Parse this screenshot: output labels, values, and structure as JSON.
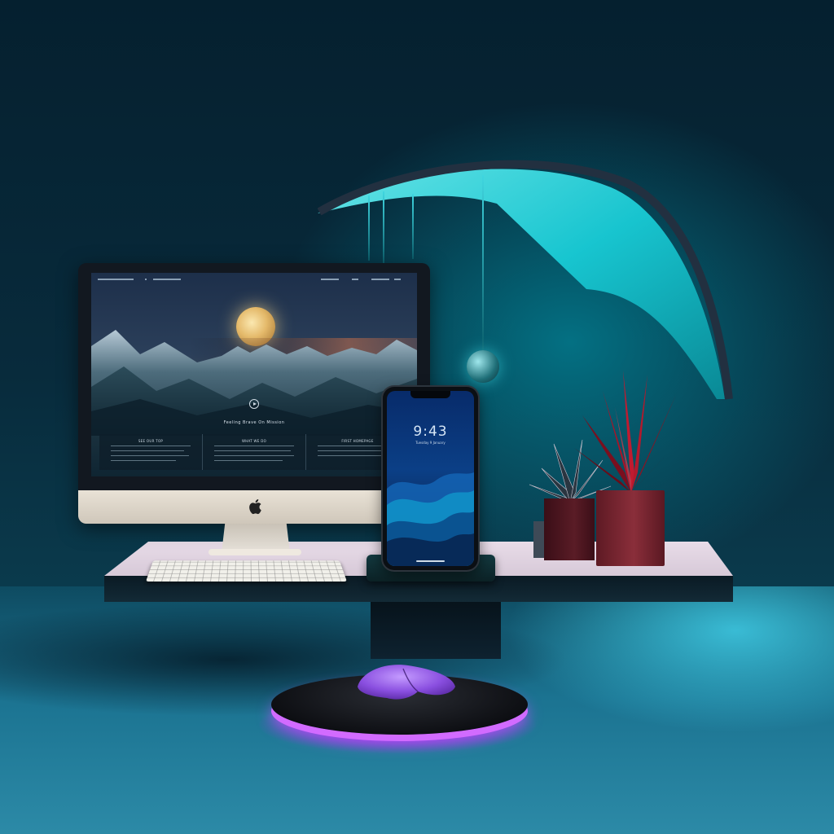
{
  "scene": {
    "colors": {
      "background": "#082b3c",
      "lamp_glow": "#29e0ea",
      "pad_glow": "#c35cff",
      "plant_red": "#c0142a"
    }
  },
  "monitor": {
    "nav_items": [
      "",
      "",
      "",
      "",
      ""
    ],
    "hero_caption": "Feeling Brave On Mission",
    "columns": [
      {
        "title": "SEE OUR TOP"
      },
      {
        "title": "WHAT WE DO"
      },
      {
        "title": "FIRST HOMEPAGE"
      }
    ],
    "logo_icon": "apple-logo-icon"
  },
  "phone": {
    "time": "9:43",
    "subtitle": "Tuesday 9 January"
  }
}
